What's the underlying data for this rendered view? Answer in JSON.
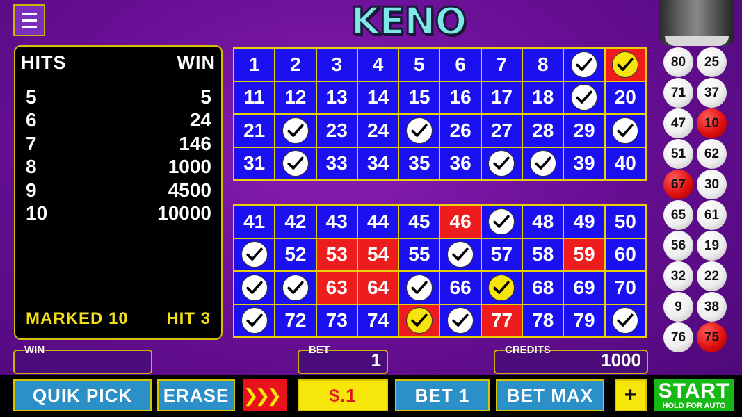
{
  "header": {
    "title": "KENO",
    "menu_icon": "hamburger-menu-icon"
  },
  "paytable": {
    "hits_header": "HITS",
    "win_header": "WIN",
    "rows": [
      {
        "hits": "5",
        "win": "5"
      },
      {
        "hits": "6",
        "win": "24"
      },
      {
        "hits": "7",
        "win": "146"
      },
      {
        "hits": "8",
        "win": "1000"
      },
      {
        "hits": "9",
        "win": "4500"
      },
      {
        "hits": "10",
        "win": "10000"
      }
    ],
    "marked_label": "MARKED 10",
    "hit_label": "HIT 3"
  },
  "board_top": [
    {
      "n": "1"
    },
    {
      "n": "2"
    },
    {
      "n": "3"
    },
    {
      "n": "4"
    },
    {
      "n": "5"
    },
    {
      "n": "6"
    },
    {
      "n": "7"
    },
    {
      "n": "8"
    },
    {
      "n": "9",
      "mark": "check"
    },
    {
      "n": "10",
      "mark": "check-yellow",
      "hit": true
    },
    {
      "n": "11"
    },
    {
      "n": "12"
    },
    {
      "n": "13"
    },
    {
      "n": "14"
    },
    {
      "n": "15"
    },
    {
      "n": "16"
    },
    {
      "n": "17"
    },
    {
      "n": "18"
    },
    {
      "n": "19",
      "mark": "check"
    },
    {
      "n": "20"
    },
    {
      "n": "21"
    },
    {
      "n": "22",
      "mark": "check"
    },
    {
      "n": "23"
    },
    {
      "n": "24"
    },
    {
      "n": "25",
      "mark": "check"
    },
    {
      "n": "26"
    },
    {
      "n": "27"
    },
    {
      "n": "28"
    },
    {
      "n": "29"
    },
    {
      "n": "30",
      "mark": "check"
    },
    {
      "n": "31"
    },
    {
      "n": "32",
      "mark": "check"
    },
    {
      "n": "33"
    },
    {
      "n": "34"
    },
    {
      "n": "35"
    },
    {
      "n": "36"
    },
    {
      "n": "37",
      "mark": "check"
    },
    {
      "n": "38",
      "mark": "check"
    },
    {
      "n": "39"
    },
    {
      "n": "40"
    }
  ],
  "board_bottom": [
    {
      "n": "41"
    },
    {
      "n": "42"
    },
    {
      "n": "43"
    },
    {
      "n": "44"
    },
    {
      "n": "45"
    },
    {
      "n": "46",
      "hit": true
    },
    {
      "n": "47",
      "mark": "check"
    },
    {
      "n": "48"
    },
    {
      "n": "49"
    },
    {
      "n": "50"
    },
    {
      "n": "51",
      "mark": "check"
    },
    {
      "n": "52"
    },
    {
      "n": "53",
      "hit": true
    },
    {
      "n": "54",
      "hit": true
    },
    {
      "n": "55"
    },
    {
      "n": "56",
      "mark": "check"
    },
    {
      "n": "57"
    },
    {
      "n": "58"
    },
    {
      "n": "59",
      "hit": true
    },
    {
      "n": "60"
    },
    {
      "n": "61",
      "mark": "check"
    },
    {
      "n": "62",
      "mark": "check"
    },
    {
      "n": "63",
      "hit": true
    },
    {
      "n": "64",
      "hit": true
    },
    {
      "n": "65",
      "mark": "check"
    },
    {
      "n": "66"
    },
    {
      "n": "67",
      "mark": "check-yellow"
    },
    {
      "n": "68"
    },
    {
      "n": "69"
    },
    {
      "n": "70"
    },
    {
      "n": "71",
      "mark": "check"
    },
    {
      "n": "72"
    },
    {
      "n": "73"
    },
    {
      "n": "74"
    },
    {
      "n": "75",
      "mark": "check-yellow",
      "hit": true
    },
    {
      "n": "76",
      "mark": "check"
    },
    {
      "n": "77",
      "hit": true
    },
    {
      "n": "78"
    },
    {
      "n": "79"
    },
    {
      "n": "80",
      "mark": "check"
    }
  ],
  "drawn_balls": [
    {
      "n": "80"
    },
    {
      "n": "25"
    },
    {
      "n": "71"
    },
    {
      "n": "37"
    },
    {
      "n": "47"
    },
    {
      "n": "10",
      "red": true
    },
    {
      "n": "51"
    },
    {
      "n": "62"
    },
    {
      "n": "67",
      "red": true
    },
    {
      "n": "30"
    },
    {
      "n": "65"
    },
    {
      "n": "61"
    },
    {
      "n": "56"
    },
    {
      "n": "19"
    },
    {
      "n": "32"
    },
    {
      "n": "22"
    },
    {
      "n": "9"
    },
    {
      "n": "38"
    },
    {
      "n": "76"
    },
    {
      "n": "75",
      "red": true
    }
  ],
  "fields": {
    "win_label": "WIN",
    "win_value": "",
    "bet_label": "BET",
    "bet_value": "1",
    "credits_label": "CREDITS",
    "credits_value": "1000"
  },
  "buttons": {
    "quik_pick": "QUIK PICK",
    "erase": "ERASE",
    "speed_icon": "fast-forward-icon",
    "denomination": "$.1",
    "bet_one": "BET 1",
    "bet_max": "BET MAX",
    "plus": "+",
    "start": "START",
    "start_sub": "HOLD FOR AUTO"
  },
  "colors": {
    "cell_blue": "#1b10f0",
    "hit_red": "#ee1c1c",
    "grid_border": "#e7d200",
    "start_green": "#16b916",
    "button_blue": "#2b8fc8",
    "denom_yellow": "#f7e609"
  }
}
